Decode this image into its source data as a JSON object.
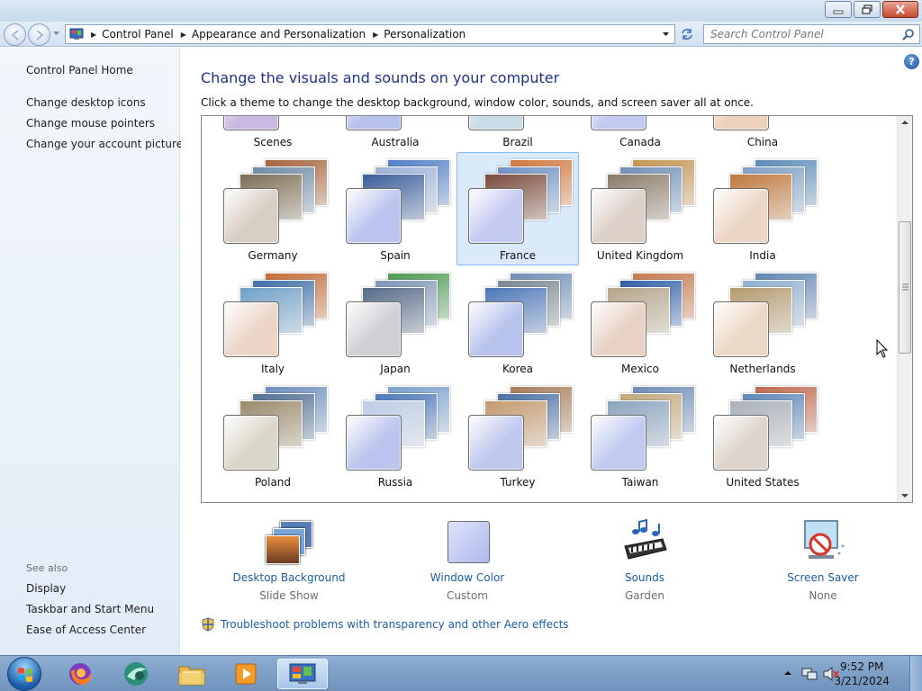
{
  "breadcrumb": [
    "Control Panel",
    "Appearance and Personalization",
    "Personalization"
  ],
  "search": {
    "placeholder": "Search Control Panel"
  },
  "help_label": "?",
  "left_pane": {
    "home": "Control Panel Home",
    "links": [
      "Change desktop icons",
      "Change mouse pointers",
      "Change your account picture"
    ],
    "see_also_title": "See also",
    "see_also": [
      "Display",
      "Taskbar and Start Menu",
      "Ease of Access Center"
    ]
  },
  "main": {
    "heading": "Change the visuals and sounds on your computer",
    "subheading": "Click a theme to change the desktop background, window color, sounds, and screen saver all at once."
  },
  "themes": [
    {
      "name": "Scenes",
      "swatch": "#c9b8e0",
      "photos": [
        "#b27db0",
        "#5a7bb5",
        "#c99a6e"
      ]
    },
    {
      "name": "Australia",
      "swatch": "#b7c2ec",
      "photos": [
        "#6f87c6",
        "#2d4f8a",
        "#c4795a"
      ]
    },
    {
      "name": "Brazil",
      "swatch": "#c9dbe6",
      "photos": [
        "#3c8b6e",
        "#4a6ea8",
        "#b0a057"
      ]
    },
    {
      "name": "Canada",
      "swatch": "#c3caf0",
      "photos": [
        "#4b6fb8",
        "#7d9bcc",
        "#37558e"
      ]
    },
    {
      "name": "China",
      "swatch": "#ecd1bd",
      "photos": [
        "#8e6a55",
        "#4a6b8f",
        "#c0884e"
      ]
    },
    {
      "name": "Germany",
      "swatch": "#d8cfc4",
      "photos": [
        "#a8633a",
        "#6e8ca8",
        "#7d6d55"
      ]
    },
    {
      "name": "Spain",
      "swatch": "#bcc5ee",
      "photos": [
        "#4f7fc8",
        "#9db3d8",
        "#3a5e9a"
      ]
    },
    {
      "name": "France",
      "swatch": "#c4c9f0",
      "photos": [
        "#d3783c",
        "#6e91c7",
        "#7a4a3a"
      ]
    },
    {
      "name": "United Kingdom",
      "swatch": "#dcd0c8",
      "photos": [
        "#c79452",
        "#6f8fb8",
        "#8a7a6a"
      ]
    },
    {
      "name": "India",
      "swatch": "#ecd6c6",
      "photos": [
        "#5b8bb9",
        "#7fa0c6",
        "#c0783c"
      ]
    },
    {
      "name": "Italy",
      "swatch": "#ecd6c8",
      "photos": [
        "#c56a36",
        "#3e6fa8",
        "#6fa0c8"
      ]
    },
    {
      "name": "Japan",
      "swatch": "#cfcfd6",
      "photos": [
        "#4c9a52",
        "#7e98b8",
        "#556a87"
      ]
    },
    {
      "name": "Korea",
      "swatch": "#b8c4ee",
      "photos": [
        "#6d8db5",
        "#7b8794",
        "#4b76b8"
      ]
    },
    {
      "name": "Mexico",
      "swatch": "#e8d2c5",
      "photos": [
        "#c6774a",
        "#2e5ea8",
        "#b5a58a"
      ]
    },
    {
      "name": "Netherlands",
      "swatch": "#ecd8c6",
      "photos": [
        "#5f86b4",
        "#8db0d0",
        "#b49a6e"
      ]
    },
    {
      "name": "Poland",
      "swatch": "#dad6c8",
      "photos": [
        "#6b8ec0",
        "#4f6e94",
        "#9a8a6a"
      ]
    },
    {
      "name": "Russia",
      "swatch": "#bcc5ee",
      "photos": [
        "#7aa0d0",
        "#4d78b8",
        "#bccde6"
      ]
    },
    {
      "name": "Turkey",
      "swatch": "#c0c8ee",
      "photos": [
        "#a77b58",
        "#4b6fa5",
        "#c49a6e"
      ]
    },
    {
      "name": "Taiwan",
      "swatch": "#c0caf0",
      "photos": [
        "#6e8cb8",
        "#c2a87a",
        "#8aa4c0"
      ]
    },
    {
      "name": "United States",
      "swatch": "#ded4cc",
      "photos": [
        "#c06a4e",
        "#5d86b8",
        "#a8b0b8"
      ]
    }
  ],
  "options": [
    {
      "label": "Desktop Background",
      "sub": "Slide Show"
    },
    {
      "label": "Window Color",
      "sub": "Custom"
    },
    {
      "label": "Sounds",
      "sub": "Garden"
    },
    {
      "label": "Screen Saver",
      "sub": "None"
    }
  ],
  "troubleshoot": "Troubleshoot problems with transparency and other Aero effects",
  "taskbar": {
    "time": "9:52 PM",
    "date": "3/21/2024"
  },
  "colors": {
    "link": "#1a5ea6",
    "heading": "#1e3287",
    "selected_tile": "#dbeafb"
  }
}
